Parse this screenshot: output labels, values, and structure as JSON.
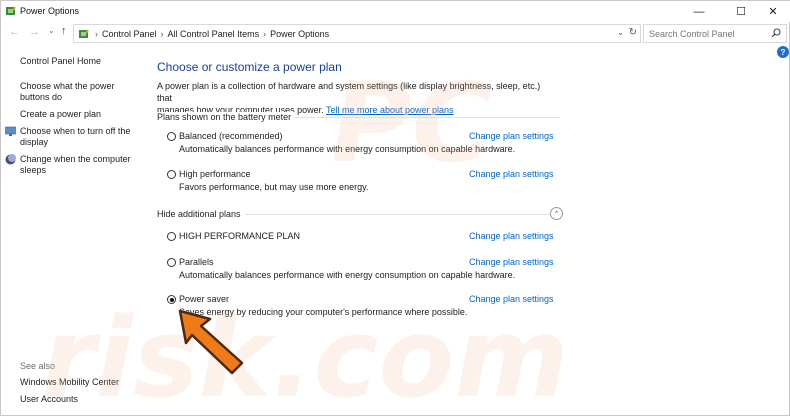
{
  "window": {
    "title": "Power Options",
    "minimize_glyph": "—",
    "maximize_glyph": "☐",
    "close_glyph": "✕"
  },
  "nav": {
    "back_glyph": "←",
    "forward_glyph": "→",
    "recent_glyph": "⌄",
    "up_glyph": "↑",
    "breadcrumbs": [
      "Control Panel",
      "All Control Panel Items",
      "Power Options"
    ],
    "separator": "›",
    "dropdown_glyph": "⌄",
    "refresh_glyph": "↻"
  },
  "search": {
    "placeholder": "Search Control Panel"
  },
  "sidebar": {
    "home": "Control Panel Home",
    "items": [
      {
        "label_line1": "Choose what the power",
        "label_line2": "buttons do"
      },
      {
        "label_line1": "Create a power plan",
        "label_line2": ""
      },
      {
        "label_line1": "Choose when to turn off the",
        "label_line2": "display"
      },
      {
        "label_line1": "Change when the computer",
        "label_line2": "sleeps"
      }
    ],
    "see_also": "See also",
    "see_also_items": [
      "Windows Mobility Center",
      "User Accounts"
    ]
  },
  "main": {
    "heading": "Choose or customize a power plan",
    "description_line1": "A power plan is a collection of hardware and system settings (like display brightness, sleep, etc.) that",
    "description_line2": "manages how your computer uses power.",
    "learn_more_link": "Tell me more about power plans",
    "section_battery": "Plans shown on the battery meter",
    "section_hidden": "Hide additional plans",
    "collapse_glyph": "⌃",
    "change_link": "Change plan settings",
    "plans": [
      {
        "name": "Balanced (recommended)",
        "desc": "Automatically balances performance with energy consumption on capable hardware.",
        "selected": false
      },
      {
        "name": "High performance",
        "desc": "Favors performance, but may use more energy.",
        "selected": false
      },
      {
        "name": "HIGH PERFORMANCE PLAN",
        "desc": "",
        "selected": false
      },
      {
        "name": "Parallels",
        "desc": "Automatically balances performance with energy consumption on capable hardware.",
        "selected": false
      },
      {
        "name": "Power saver",
        "desc": "Saves energy by reducing your computer's performance where possible.",
        "selected": true
      }
    ]
  },
  "help_glyph": "?",
  "watermark": {
    "line1": "PC",
    "line2": "risk.com"
  },
  "colors": {
    "heading": "#1a3f96",
    "link": "#0066cc",
    "arrow_fill": "#f07a18",
    "arrow_stroke": "#4a2a10",
    "help": "#1f6fd1"
  }
}
